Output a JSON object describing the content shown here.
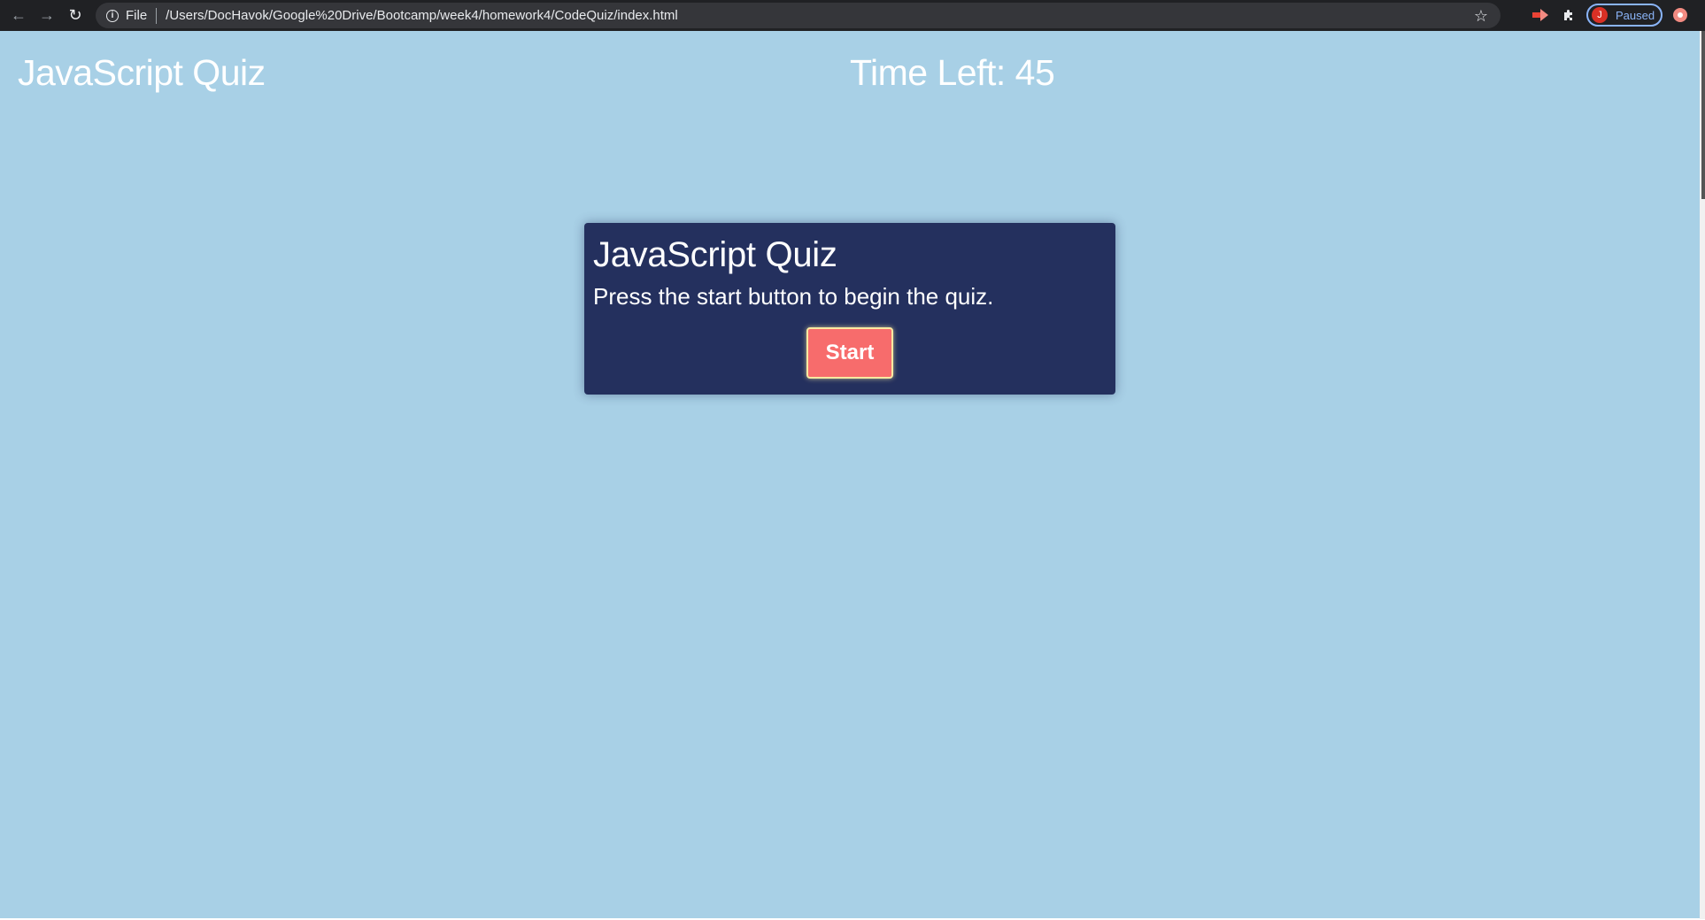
{
  "browser": {
    "scheme_label": "File",
    "url": "/Users/DocHavok/Google%20Drive/Bootcamp/week4/homework4/CodeQuiz/index.html",
    "profile_initial": "J",
    "profile_status": "Paused",
    "icons": {
      "back": "arrow-left-icon",
      "forward": "arrow-right-icon",
      "reload": "reload-icon",
      "info": "info-icon",
      "bookmark": "star-icon",
      "extension_cast": "cast-extension-icon",
      "extensions": "puzzle-icon",
      "update": "update-icon"
    }
  },
  "page": {
    "header_title": "JavaScript Quiz",
    "time_left_label": "Time Left: 45",
    "background_color": "#a8d0e6"
  },
  "card": {
    "title": "JavaScript Quiz",
    "instructions": "Press the start button to begin the quiz.",
    "start_label": "Start",
    "background_color": "#24305e",
    "button_color": "#f76c6c"
  }
}
